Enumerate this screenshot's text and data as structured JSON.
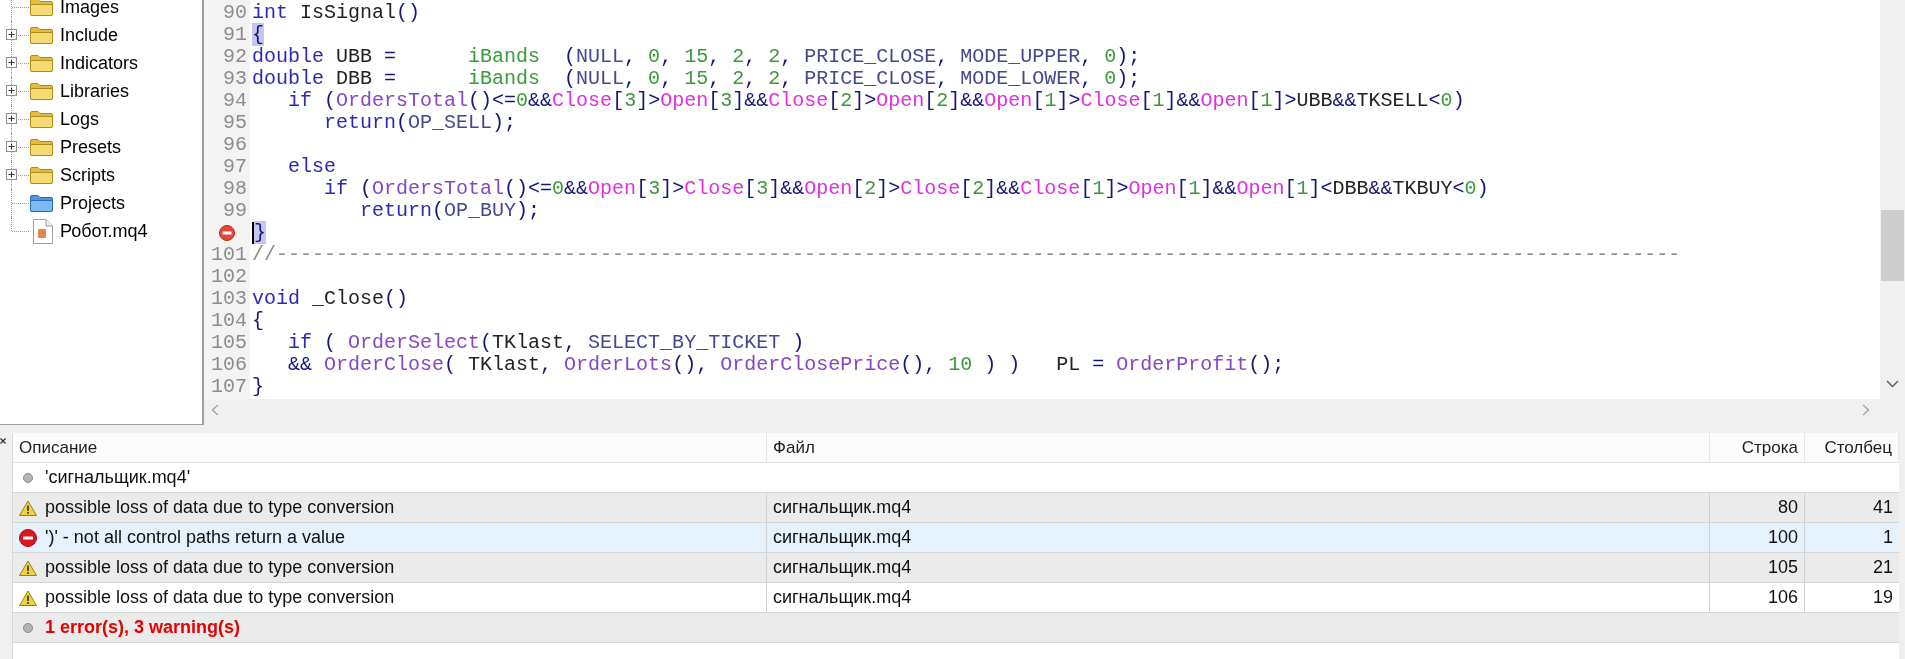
{
  "tree": {
    "items": [
      {
        "label": "Images",
        "kind": "folder"
      },
      {
        "label": "Include",
        "kind": "folder",
        "expanded": false
      },
      {
        "label": "Indicators",
        "kind": "folder",
        "expanded": false
      },
      {
        "label": "Libraries",
        "kind": "folder",
        "expanded": false
      },
      {
        "label": "Logs",
        "kind": "folder",
        "expanded": false
      },
      {
        "label": "Presets",
        "kind": "folder",
        "expanded": false
      },
      {
        "label": "Scripts",
        "kind": "folder",
        "expanded": false
      },
      {
        "label": "Projects",
        "kind": "project_folder"
      },
      {
        "label": "Робот.mq4",
        "kind": "file"
      }
    ]
  },
  "editor": {
    "lines": [
      {
        "number": "90",
        "error": false,
        "cursor": false,
        "tokens": [
          {
            "kind": "keyword",
            "text": "int"
          },
          {
            "kind": "ident",
            "text": " IsSignal"
          },
          {
            "kind": "punct",
            "text": "()"
          }
        ]
      },
      {
        "number": "91",
        "error": false,
        "cursor": false,
        "tokens": [
          {
            "kind": "brace_match",
            "text": "{"
          }
        ]
      },
      {
        "number": "92",
        "error": false,
        "cursor": false,
        "tokens": [
          {
            "kind": "keyword",
            "text": "double"
          },
          {
            "kind": "ident",
            "text": " UBB"
          },
          {
            "kind": "punct",
            "text": " =      "
          },
          {
            "kind": "indicator",
            "text": "iBands"
          },
          {
            "kind": "punct",
            "text": "  ("
          },
          {
            "kind": "constant",
            "text": "NULL"
          },
          {
            "kind": "punct",
            "text": ", "
          },
          {
            "kind": "number",
            "text": "0"
          },
          {
            "kind": "punct",
            "text": ", "
          },
          {
            "kind": "number",
            "text": "15"
          },
          {
            "kind": "punct",
            "text": ", "
          },
          {
            "kind": "number",
            "text": "2"
          },
          {
            "kind": "punct",
            "text": ", "
          },
          {
            "kind": "number",
            "text": "2"
          },
          {
            "kind": "punct",
            "text": ", "
          },
          {
            "kind": "constant",
            "text": "PRICE_CLOSE"
          },
          {
            "kind": "punct",
            "text": ", "
          },
          {
            "kind": "constant",
            "text": "MODE_UPPER"
          },
          {
            "kind": "punct",
            "text": ", "
          },
          {
            "kind": "number",
            "text": "0"
          },
          {
            "kind": "punct",
            "text": ");"
          }
        ]
      },
      {
        "number": "93",
        "error": false,
        "cursor": false,
        "tokens": [
          {
            "kind": "keyword",
            "text": "double"
          },
          {
            "kind": "ident",
            "text": " DBB"
          },
          {
            "kind": "punct",
            "text": " =      "
          },
          {
            "kind": "indicator",
            "text": "iBands"
          },
          {
            "kind": "punct",
            "text": "  ("
          },
          {
            "kind": "constant",
            "text": "NULL"
          },
          {
            "kind": "punct",
            "text": ", "
          },
          {
            "kind": "number",
            "text": "0"
          },
          {
            "kind": "punct",
            "text": ", "
          },
          {
            "kind": "number",
            "text": "15"
          },
          {
            "kind": "punct",
            "text": ", "
          },
          {
            "kind": "number",
            "text": "2"
          },
          {
            "kind": "punct",
            "text": ", "
          },
          {
            "kind": "number",
            "text": "2"
          },
          {
            "kind": "punct",
            "text": ", "
          },
          {
            "kind": "constant",
            "text": "PRICE_CLOSE"
          },
          {
            "kind": "punct",
            "text": ", "
          },
          {
            "kind": "constant",
            "text": "MODE_LOWER"
          },
          {
            "kind": "punct",
            "text": ", "
          },
          {
            "kind": "number",
            "text": "0"
          },
          {
            "kind": "punct",
            "text": ");"
          }
        ]
      },
      {
        "number": "94",
        "error": false,
        "cursor": false,
        "tokens": [
          {
            "kind": "keyword",
            "text": "   if"
          },
          {
            "kind": "punct",
            "text": " ("
          },
          {
            "kind": "func",
            "text": "OrdersTotal"
          },
          {
            "kind": "punct",
            "text": "()<="
          },
          {
            "kind": "number",
            "text": "0"
          },
          {
            "kind": "punct",
            "text": "&&"
          },
          {
            "kind": "array",
            "text": "Close"
          },
          {
            "kind": "punct",
            "text": "["
          },
          {
            "kind": "number",
            "text": "3"
          },
          {
            "kind": "punct",
            "text": "]>"
          },
          {
            "kind": "array",
            "text": "Open"
          },
          {
            "kind": "punct",
            "text": "["
          },
          {
            "kind": "number",
            "text": "3"
          },
          {
            "kind": "punct",
            "text": "]&&"
          },
          {
            "kind": "array",
            "text": "Close"
          },
          {
            "kind": "punct",
            "text": "["
          },
          {
            "kind": "number",
            "text": "2"
          },
          {
            "kind": "punct",
            "text": "]>"
          },
          {
            "kind": "array",
            "text": "Open"
          },
          {
            "kind": "punct",
            "text": "["
          },
          {
            "kind": "number",
            "text": "2"
          },
          {
            "kind": "punct",
            "text": "]&&"
          },
          {
            "kind": "array",
            "text": "Open"
          },
          {
            "kind": "punct",
            "text": "["
          },
          {
            "kind": "number",
            "text": "1"
          },
          {
            "kind": "punct",
            "text": "]>"
          },
          {
            "kind": "array",
            "text": "Close"
          },
          {
            "kind": "punct",
            "text": "["
          },
          {
            "kind": "number",
            "text": "1"
          },
          {
            "kind": "punct",
            "text": "]&&"
          },
          {
            "kind": "array",
            "text": "Open"
          },
          {
            "kind": "punct",
            "text": "["
          },
          {
            "kind": "number",
            "text": "1"
          },
          {
            "kind": "punct",
            "text": "]>"
          },
          {
            "kind": "ident",
            "text": "UBB"
          },
          {
            "kind": "punct",
            "text": "&&"
          },
          {
            "kind": "ident",
            "text": "TKSELL"
          },
          {
            "kind": "punct",
            "text": "<"
          },
          {
            "kind": "number",
            "text": "0"
          },
          {
            "kind": "punct",
            "text": ")"
          }
        ]
      },
      {
        "number": "95",
        "error": false,
        "cursor": false,
        "tokens": [
          {
            "kind": "keyword",
            "text": "      return"
          },
          {
            "kind": "punct",
            "text": "("
          },
          {
            "kind": "constant",
            "text": "OP_SELL"
          },
          {
            "kind": "punct",
            "text": ");"
          }
        ]
      },
      {
        "number": "96",
        "error": false,
        "cursor": false
      },
      {
        "number": "97",
        "error": false,
        "cursor": false,
        "tokens": [
          {
            "kind": "keyword",
            "text": "   else"
          }
        ]
      },
      {
        "number": "98",
        "error": false,
        "cursor": false,
        "tokens": [
          {
            "kind": "keyword",
            "text": "      if"
          },
          {
            "kind": "punct",
            "text": " ("
          },
          {
            "kind": "func",
            "text": "OrdersTotal"
          },
          {
            "kind": "punct",
            "text": "()<="
          },
          {
            "kind": "number",
            "text": "0"
          },
          {
            "kind": "punct",
            "text": "&&"
          },
          {
            "kind": "array",
            "text": "Open"
          },
          {
            "kind": "punct",
            "text": "["
          },
          {
            "kind": "number",
            "text": "3"
          },
          {
            "kind": "punct",
            "text": "]>"
          },
          {
            "kind": "array",
            "text": "Close"
          },
          {
            "kind": "punct",
            "text": "["
          },
          {
            "kind": "number",
            "text": "3"
          },
          {
            "kind": "punct",
            "text": "]&&"
          },
          {
            "kind": "array",
            "text": "Open"
          },
          {
            "kind": "punct",
            "text": "["
          },
          {
            "kind": "number",
            "text": "2"
          },
          {
            "kind": "punct",
            "text": "]>"
          },
          {
            "kind": "array",
            "text": "Close"
          },
          {
            "kind": "punct",
            "text": "["
          },
          {
            "kind": "number",
            "text": "2"
          },
          {
            "kind": "punct",
            "text": "]&&"
          },
          {
            "kind": "array",
            "text": "Close"
          },
          {
            "kind": "punct",
            "text": "["
          },
          {
            "kind": "number",
            "text": "1"
          },
          {
            "kind": "punct",
            "text": "]>"
          },
          {
            "kind": "array",
            "text": "Open"
          },
          {
            "kind": "punct",
            "text": "["
          },
          {
            "kind": "number",
            "text": "1"
          },
          {
            "kind": "punct",
            "text": "]&&"
          },
          {
            "kind": "array",
            "text": "Open"
          },
          {
            "kind": "punct",
            "text": "["
          },
          {
            "kind": "number",
            "text": "1"
          },
          {
            "kind": "punct",
            "text": "]<"
          },
          {
            "kind": "ident",
            "text": "DBB"
          },
          {
            "kind": "punct",
            "text": "&&"
          },
          {
            "kind": "ident",
            "text": "TKBUY"
          },
          {
            "kind": "punct",
            "text": "<"
          },
          {
            "kind": "number",
            "text": "0"
          },
          {
            "kind": "punct",
            "text": ")"
          }
        ]
      },
      {
        "number": "99",
        "error": false,
        "cursor": false,
        "tokens": [
          {
            "kind": "keyword",
            "text": "         return"
          },
          {
            "kind": "punct",
            "text": "("
          },
          {
            "kind": "constant",
            "text": "OP_BUY"
          },
          {
            "kind": "punct",
            "text": ");"
          }
        ]
      },
      {
        "error": true,
        "cursor": true,
        "tokens": [
          {
            "kind": "brace_match",
            "text": "}"
          }
        ]
      },
      {
        "number": "101",
        "error": false,
        "cursor": false,
        "tokens": [
          {
            "kind": "comment",
            "text": "//---------------------------------------------------------------------------------------------------------------------"
          }
        ]
      },
      {
        "number": "102",
        "error": false,
        "cursor": false
      },
      {
        "number": "103",
        "error": false,
        "cursor": false,
        "tokens": [
          {
            "kind": "keyword",
            "text": "void"
          },
          {
            "kind": "ident",
            "text": " _Close"
          },
          {
            "kind": "punct",
            "text": "()"
          }
        ]
      },
      {
        "number": "104",
        "error": false,
        "cursor": false,
        "tokens": [
          {
            "kind": "punct",
            "text": "{"
          }
        ]
      },
      {
        "number": "105",
        "error": false,
        "cursor": false,
        "tokens": [
          {
            "kind": "keyword",
            "text": "   if"
          },
          {
            "kind": "punct",
            "text": " ( "
          },
          {
            "kind": "func",
            "text": "OrderSelect"
          },
          {
            "kind": "punct",
            "text": "("
          },
          {
            "kind": "ident",
            "text": "TKlast"
          },
          {
            "kind": "punct",
            "text": ", "
          },
          {
            "kind": "constant",
            "text": "SELECT_BY_TICKET"
          },
          {
            "kind": "punct",
            "text": " )"
          }
        ]
      },
      {
        "number": "106",
        "error": false,
        "cursor": false,
        "tokens": [
          {
            "kind": "punct",
            "text": "   && "
          },
          {
            "kind": "func",
            "text": "OrderClose"
          },
          {
            "kind": "punct",
            "text": "( "
          },
          {
            "kind": "ident",
            "text": "TKlast"
          },
          {
            "kind": "punct",
            "text": ", "
          },
          {
            "kind": "func",
            "text": "OrderLots"
          },
          {
            "kind": "punct",
            "text": "(), "
          },
          {
            "kind": "func",
            "text": "OrderClosePrice"
          },
          {
            "kind": "punct",
            "text": "(), "
          },
          {
            "kind": "number",
            "text": "10"
          },
          {
            "kind": "punct",
            "text": " ) )   "
          },
          {
            "kind": "ident",
            "text": "PL"
          },
          {
            "kind": "punct",
            "text": " = "
          },
          {
            "kind": "func",
            "text": "OrderProfit"
          },
          {
            "kind": "punct",
            "text": "();"
          }
        ]
      },
      {
        "number": "107",
        "error": false,
        "cursor": false,
        "tokens": [
          {
            "kind": "punct",
            "text": "}"
          }
        ]
      }
    ]
  },
  "messages": {
    "columns": [
      "Описание",
      "Файл",
      "Строка",
      "Столбец"
    ],
    "rows": [
      {
        "kind": "info",
        "description": "'сигнальщик.mq4'",
        "selected": false
      },
      {
        "kind": "warning",
        "description": "possible loss of data due to type conversion",
        "file": "сигнальщик.mq4",
        "line": "80",
        "column": "41",
        "selected": false
      },
      {
        "kind": "error",
        "description": "')' - not all control paths return a value",
        "file": "сигнальщик.mq4",
        "line": "100",
        "column": "1",
        "selected": true
      },
      {
        "kind": "warning",
        "description": "possible loss of data due to type conversion",
        "file": "сигнальщик.mq4",
        "line": "105",
        "column": "21",
        "selected": false
      },
      {
        "kind": "warning",
        "description": "possible loss of data due to type conversion",
        "file": "сигнальщик.mq4",
        "line": "106",
        "column": "19",
        "selected": false
      },
      {
        "kind": "result",
        "description": "1 error(s), 3 warning(s)",
        "selected": false
      }
    ]
  }
}
